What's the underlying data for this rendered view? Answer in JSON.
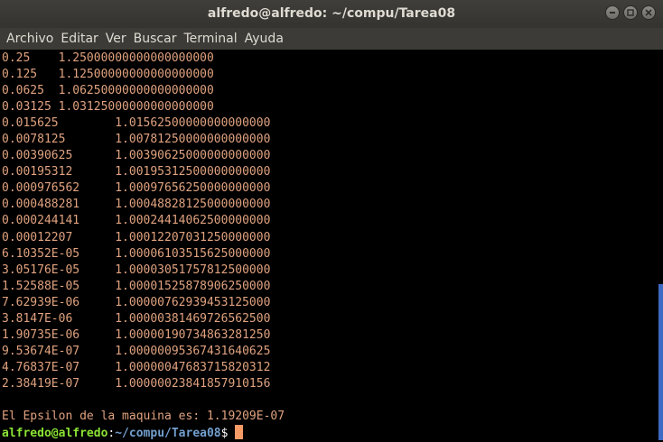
{
  "window": {
    "title": "alfredo@alfredo: ~/compu/Tarea08"
  },
  "menubar": {
    "items": [
      "Archivo",
      "Editar",
      "Ver",
      "Buscar",
      "Terminal",
      "Ayuda"
    ]
  },
  "terminal": {
    "lines": [
      "0.25    1.25000000000000000000",
      "0.125   1.12500000000000000000",
      "0.0625  1.06250000000000000000",
      "0.03125 1.03125000000000000000",
      "0.015625        1.01562500000000000000",
      "0.0078125       1.00781250000000000000",
      "0.00390625      1.00390625000000000000",
      "0.00195312      1.00195312500000000000",
      "0.000976562     1.00097656250000000000",
      "0.000488281     1.00048828125000000000",
      "0.000244141     1.00024414062500000000",
      "0.00012207      1.00012207031250000000",
      "6.10352E-05     1.00006103515625000000",
      "3.05176E-05     1.00003051757812500000",
      "1.52588E-05     1.00001525878906250000",
      "7.62939E-06     1.00000762939453125000",
      "3.8147E-06      1.00000381469726562500",
      "1.90735E-06     1.00000190734863281250",
      "9.53674E-07     1.00000095367431640625",
      "4.76837E-07     1.00000047683715820312",
      "2.38419E-07     1.00000023841857910156",
      "",
      "El Epsilon de la maquina es: 1.19209E-07"
    ],
    "prompt": {
      "user_host": "alfredo@alfredo",
      "separator": ":",
      "path": "~/compu/Tarea08",
      "symbol": "$"
    }
  },
  "colors": {
    "output_text": "#e0a27f",
    "prompt_user": "#8ae234",
    "prompt_path": "#729fcf",
    "cursor": "#f79b66",
    "background": "#000000",
    "scrollbar": "#3f6ac3"
  },
  "icons": {
    "minimize": "minimize-icon",
    "maximize": "maximize-icon",
    "close": "close-icon"
  }
}
